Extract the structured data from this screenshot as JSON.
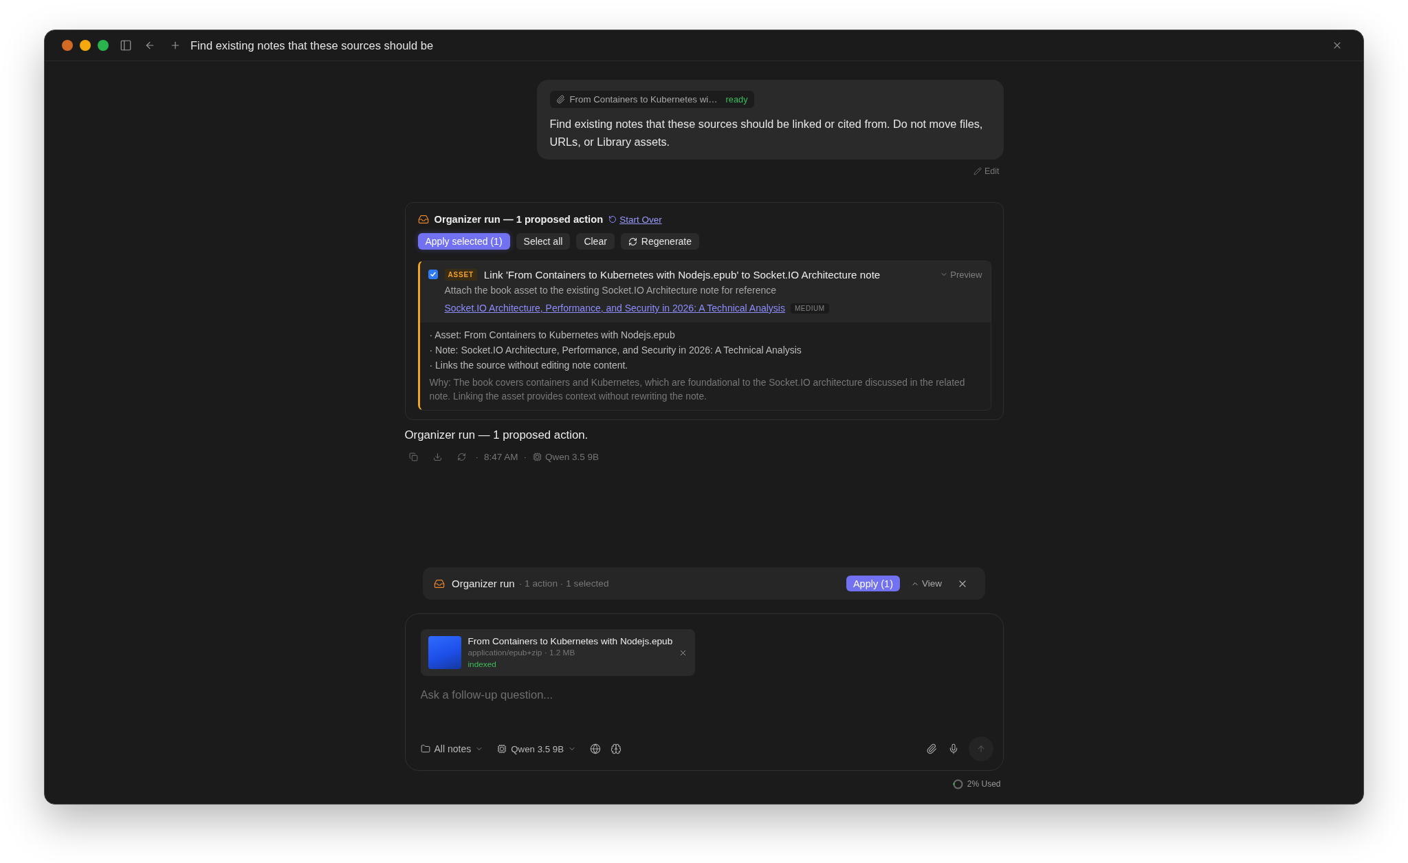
{
  "window": {
    "title": "Find existing notes that these sources should be"
  },
  "user_message": {
    "attachment": {
      "name": "From Containers to Kubernetes wi…",
      "status": "ready"
    },
    "text": "Find existing notes that these sources should be linked or cited from. Do not move files, URLs, or Library assets.",
    "edit_label": "Edit"
  },
  "organizer_card": {
    "title": "Organizer run — 1 proposed action",
    "start_over": "Start Over",
    "buttons": [
      {
        "label": "Apply selected (1)",
        "kind": "primary"
      },
      {
        "label": "Select all",
        "kind": "secondary"
      },
      {
        "label": "Clear",
        "kind": "secondary"
      },
      {
        "label": "Regenerate",
        "kind": "regenerate"
      }
    ],
    "actions": [
      {
        "checked": true,
        "tag": "ASSET",
        "title": "Link 'From Containers to Kubernetes with Nodejs.epub' to Socket.IO Architecture note",
        "preview_label": "Preview",
        "description": "Attach the book asset to the existing Socket.IO Architecture note for reference",
        "link": "Socket.IO Architecture, Performance, and Security in 2026: A Technical Analysis",
        "confidence": "MEDIUM",
        "details": [
          "· Asset: From Containers to Kubernetes with Nodejs.epub",
          "· Note: Socket.IO Architecture, Performance, and Security in 2026: A Technical Analysis",
          "· Links the source without editing note content."
        ],
        "why": "Why: The book covers containers and Kubernetes, which are foundational to the Socket.IO architecture discussed in the related note. Linking the asset provides context without rewriting the note."
      }
    ]
  },
  "response": {
    "text": "Organizer run — 1 proposed action.",
    "separators": [
      "·",
      "·"
    ],
    "time": "8:47 AM",
    "model": "Qwen 3.5 9B"
  },
  "organizer_bar": {
    "title": "Organizer run",
    "summary": "· 1 action · 1 selected",
    "apply_label": "Apply (1)",
    "view_label": "View"
  },
  "composer": {
    "attachment": {
      "name": "From Containers to Kubernetes with Nodejs.epub",
      "meta": "application/epub+zip · 1.2 MB",
      "status": "indexed"
    },
    "placeholder": "Ask a follow-up question...",
    "scope": "All notes",
    "model": "Qwen 3.5 9B"
  },
  "usage": {
    "label": "2% Used",
    "level": 0.02
  }
}
